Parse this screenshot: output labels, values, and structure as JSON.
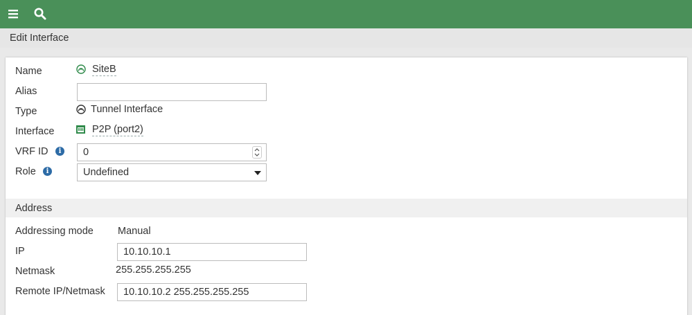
{
  "topbar": {
    "menu_icon": "hamburger-menu-icon",
    "search_icon": "search-icon",
    "color": "#4a9059"
  },
  "page": {
    "title": "Edit Interface"
  },
  "form": {
    "name": {
      "label": "Name",
      "value": "SiteB",
      "icon": "tunnel-interface-icon"
    },
    "alias": {
      "label": "Alias",
      "value": ""
    },
    "type": {
      "label": "Type",
      "value": "Tunnel Interface",
      "icon": "tunnel-interface-icon"
    },
    "interface": {
      "label": "Interface",
      "value": "P2P (port2)",
      "icon": "network-port-icon"
    },
    "vrf_id": {
      "label": "VRF ID",
      "value": "0"
    },
    "role": {
      "label": "Role",
      "value": "Undefined"
    }
  },
  "address": {
    "section_title": "Address",
    "addressing_mode": {
      "label": "Addressing mode",
      "value": "Manual"
    },
    "ip": {
      "label": "IP",
      "value": "10.10.10.1"
    },
    "netmask": {
      "label": "Netmask",
      "value": "255.255.255.255"
    },
    "remote": {
      "label": "Remote IP/Netmask",
      "value": "10.10.10.2 255.255.255.255"
    }
  }
}
